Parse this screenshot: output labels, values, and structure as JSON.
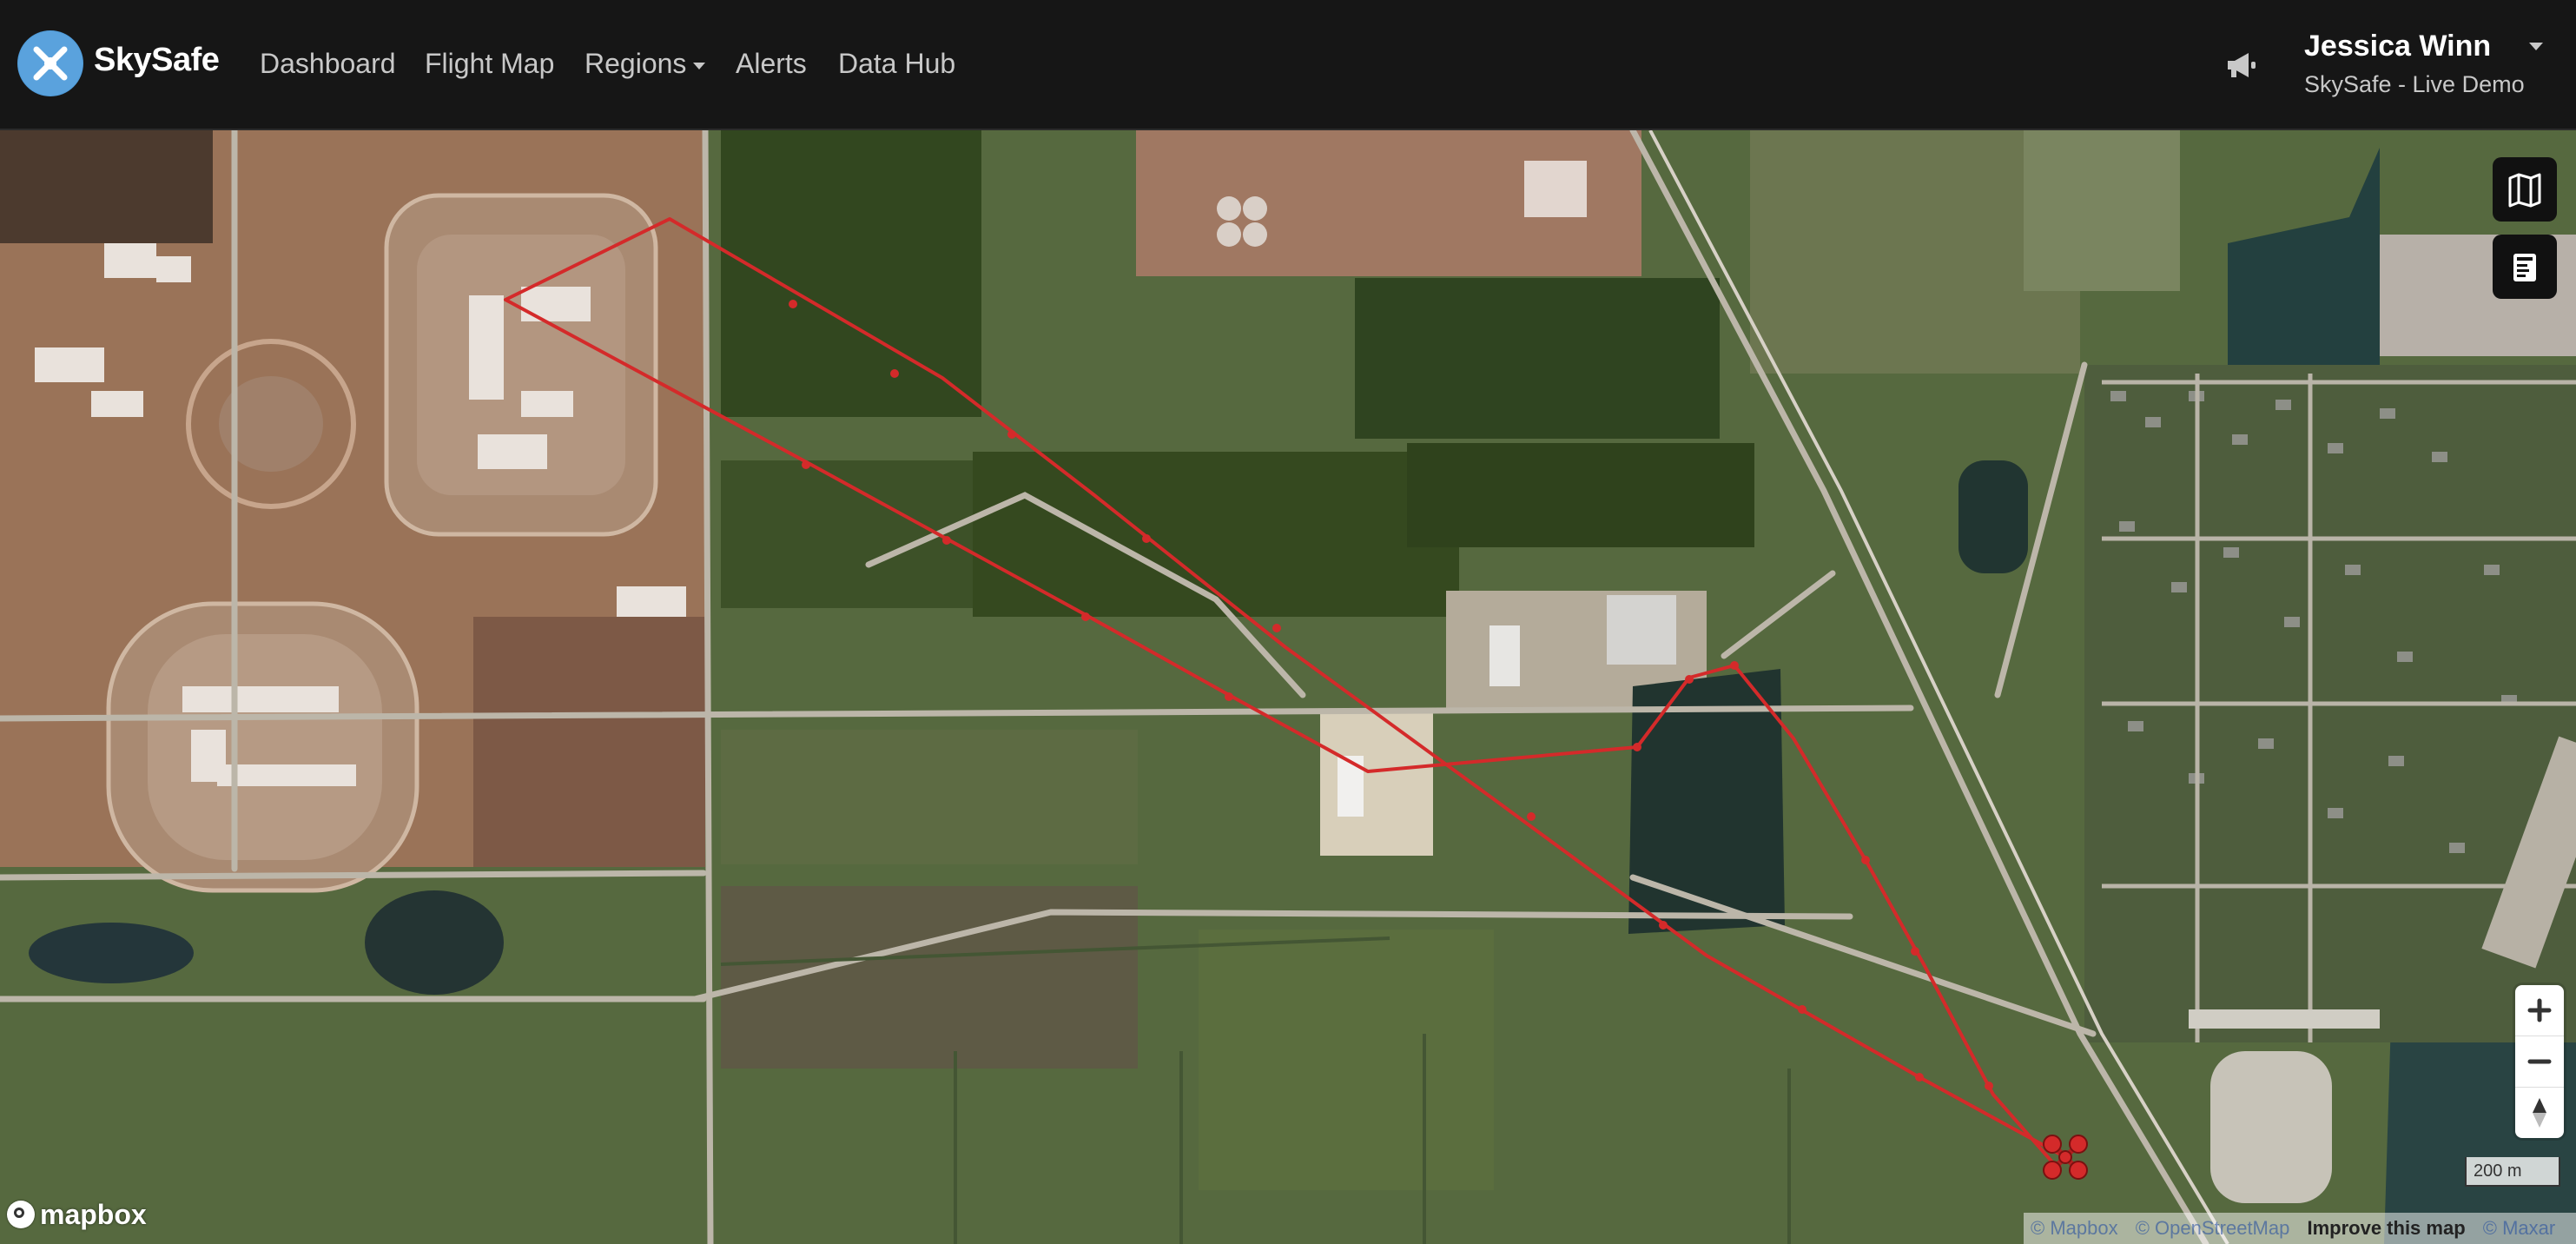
{
  "navbar": {
    "brand_name": "SkySafe",
    "links": [
      {
        "label": "Dashboard"
      },
      {
        "label": "Flight Map"
      },
      {
        "label": "Regions",
        "has_dropdown": true
      },
      {
        "label": "Alerts"
      },
      {
        "label": "Data Hub"
      }
    ],
    "user": {
      "name": "Jessica Winn",
      "organization": "SkySafe - Live Demo"
    }
  },
  "map": {
    "scale_label": "200 m",
    "logo_label": "mapbox",
    "attribution": {
      "mapbox": "© Mapbox",
      "osm": "© OpenStreetMap",
      "improve": "Improve this map",
      "maxar": "© Maxar"
    },
    "flight_path_color": "#d42a2a",
    "icons": {
      "drone": "drone-icon",
      "layers": "map-layers-icon",
      "legend": "legend-icon",
      "zoom_in": "plus-icon",
      "zoom_out": "minus-icon",
      "compass": "compass-icon",
      "announcements": "megaphone-icon"
    }
  }
}
